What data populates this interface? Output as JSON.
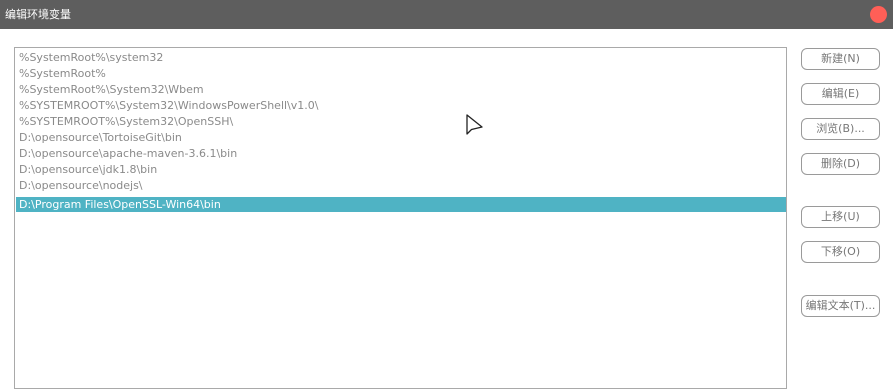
{
  "window": {
    "title": "编辑环境变量",
    "close_color": "#ff5f57",
    "close_icon": "close-icon"
  },
  "paths": [
    "%SystemRoot%\\system32",
    "%SystemRoot%",
    "%SystemRoot%\\System32\\Wbem",
    "%SYSTEMROOT%\\System32\\WindowsPowerShell\\v1.0\\",
    "%SYSTEMROOT%\\System32\\OpenSSH\\",
    "D:\\opensource\\TortoiseGit\\bin",
    "D:\\opensource\\apache-maven-3.6.1\\bin",
    "D:\\opensource\\jdk1.8\\bin",
    "D:\\opensource\\nodejs\\",
    "D:\\Program Files\\OpenSSL-Win64\\bin"
  ],
  "selected_index": 9,
  "selection_color": "#4fb3c4",
  "buttons": {
    "new": "新建(N)",
    "edit": "编辑(E)",
    "browse": "浏览(B)...",
    "delete": "删除(D)",
    "move_up": "上移(U)",
    "move_down": "下移(O)",
    "edit_text": "编辑文本(T)..."
  },
  "pointer_icon": "mouse-pointer-icon"
}
